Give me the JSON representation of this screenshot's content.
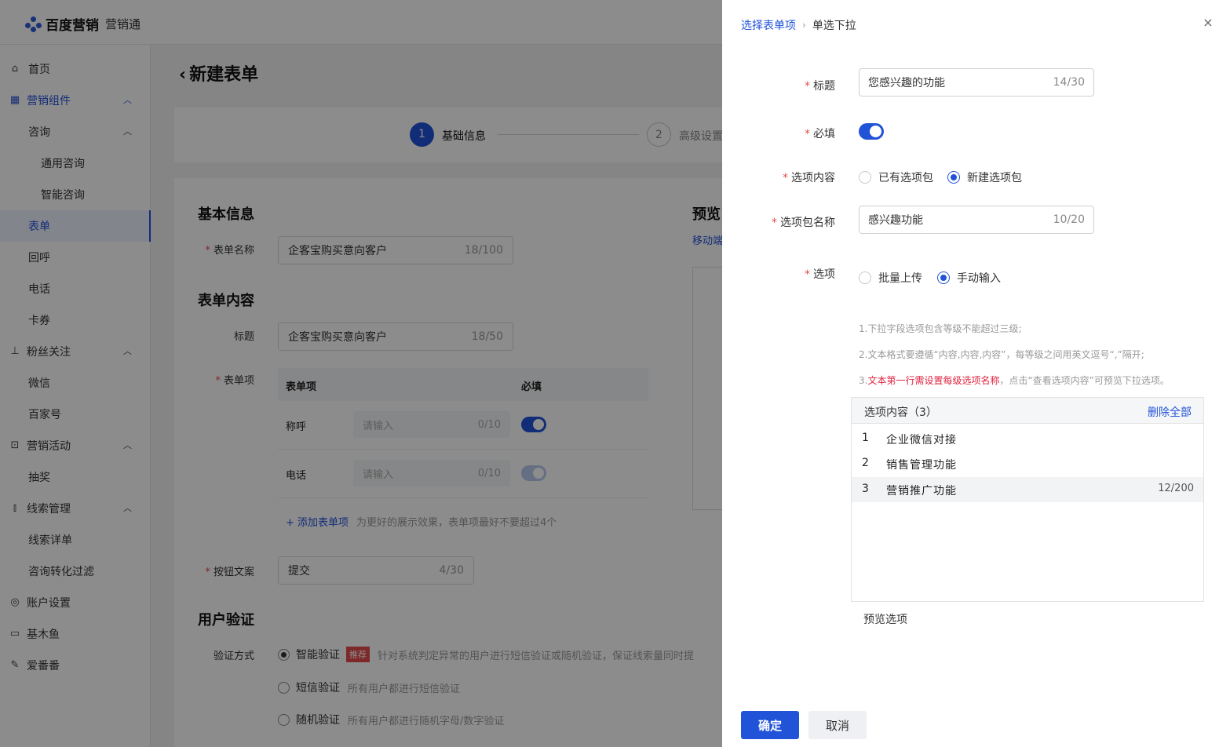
{
  "brand": {
    "name": "百度营销",
    "product": "营销通"
  },
  "sidebar": {
    "items": [
      {
        "label": "首页",
        "icon": "home-icon"
      },
      {
        "label": "营销组件",
        "icon": "grid-icon"
      },
      {
        "label": "咨询"
      },
      {
        "label": "通用咨询"
      },
      {
        "label": "智能咨询"
      },
      {
        "label": "表单"
      },
      {
        "label": "回呼"
      },
      {
        "label": "电话"
      },
      {
        "label": "卡券"
      },
      {
        "label": "粉丝关注",
        "icon": "bar-chart-icon"
      },
      {
        "label": "微信"
      },
      {
        "label": "百家号"
      },
      {
        "label": "营销活动",
        "icon": "activity-icon"
      },
      {
        "label": "抽奖"
      },
      {
        "label": "线索管理",
        "icon": "chart-icon"
      },
      {
        "label": "线索详单"
      },
      {
        "label": "咨询转化过滤"
      },
      {
        "label": "账户设置",
        "icon": "settings-icon"
      },
      {
        "label": "基木鱼",
        "icon": "fish-icon"
      },
      {
        "label": "爱番番",
        "icon": "pen-icon"
      }
    ]
  },
  "page": {
    "title": "新建表单",
    "steps": [
      {
        "num": "1",
        "label": "基础信息"
      },
      {
        "num": "2",
        "label": "高级设置"
      }
    ],
    "basic_section": "基本信息",
    "form_name_label": "表单名称",
    "form_name_value": "企客宝购买意向客户",
    "form_name_count": "18/100",
    "content_section": "表单内容",
    "title_label": "标题",
    "title_value": "企客宝购买意向客户",
    "title_count": "18/50",
    "items_label": "表单项",
    "table_headers": {
      "item": "表单项",
      "required": "必填"
    },
    "rows": [
      {
        "name": "称呼",
        "placeholder": "请输入",
        "count": "0/10"
      },
      {
        "name": "电话",
        "placeholder": "请输入",
        "count": "0/10"
      }
    ],
    "add_item": "+ 添加表单项",
    "add_item_hint": "为更好的展示效果，表单项最好不要超过4个",
    "button_text_label": "按钮文案",
    "button_text_value": "提交",
    "button_text_count": "4/30",
    "verify_section": "用户验证",
    "verify_label": "验证方式",
    "verify_options": [
      {
        "label": "智能验证",
        "tag": "推荐",
        "hint": "针对系统判定异常的用户进行短信验证或随机验证，保证线索量同时提"
      },
      {
        "label": "短信验证",
        "hint": "所有用户都进行短信验证"
      },
      {
        "label": "随机验证",
        "hint": "所有用户都进行随机字母/数字验证"
      }
    ],
    "preview_title": "预览",
    "preview_tab": "移动端"
  },
  "drawer": {
    "breadcrumb": {
      "parent": "选择表单项",
      "current": "单选下拉"
    },
    "title_label": "标题",
    "title_value": "您感兴趣的功能",
    "title_count": "14/30",
    "required_label": "必填",
    "required_on": true,
    "content_label": "选项内容",
    "content_options": [
      "已有选项包",
      "新建选项包"
    ],
    "content_selected": "新建选项包",
    "package_label": "选项包名称",
    "package_value": "感兴趣功能",
    "package_count": "10/20",
    "options_label": "选项",
    "options_modes": [
      "批量上传",
      "手动输入"
    ],
    "options_mode_selected": "手动输入",
    "notes": {
      "n1": "1.下拉字段选项包含等级不能超过三级;",
      "n2": "2.文本格式要遵循“内容,内容,内容”，每等级之间用英文逗号“,”隔开;",
      "n3_prefix": "3.",
      "n3_red": "文本第一行需设置每级选项名称",
      "n3_suffix": "，点击“查看选项内容”可预览下拉选项。"
    },
    "list_title": "选项内容（3）",
    "delete_all": "删除全部",
    "list": [
      {
        "index": "1",
        "text": "企业微信对接",
        "count": ""
      },
      {
        "index": "2",
        "text": "销售管理功能",
        "count": ""
      },
      {
        "index": "3",
        "text": "营销推广功能",
        "count": "12/200"
      }
    ],
    "preview_options": "预览选项",
    "confirm": "确定",
    "cancel": "取消",
    "accent_color": "#2153d9"
  }
}
